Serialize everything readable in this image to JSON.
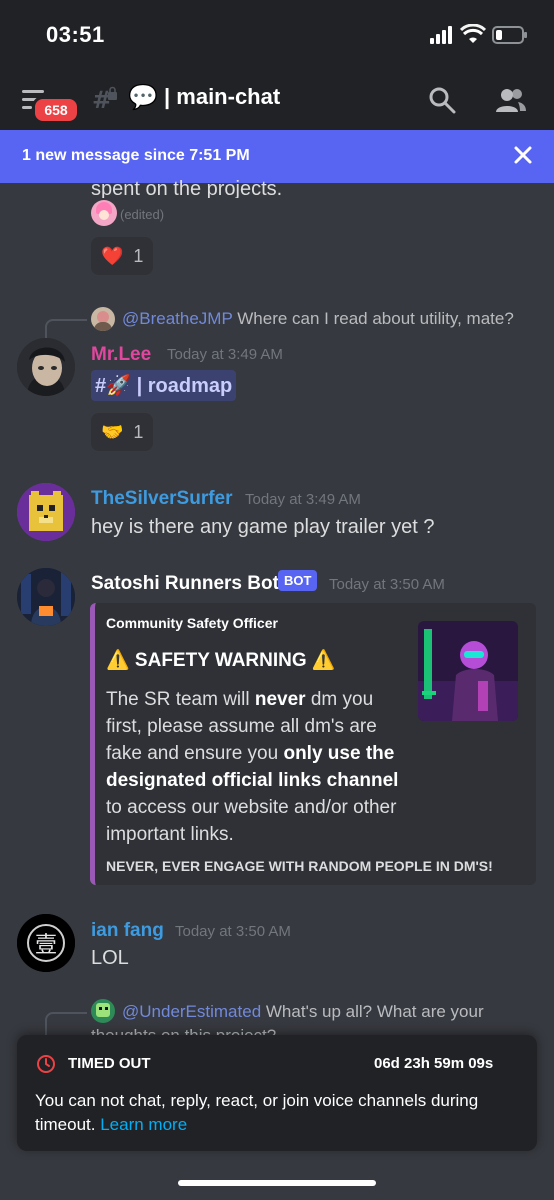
{
  "status_bar": {
    "time": "03:51"
  },
  "header": {
    "badge_count": "658",
    "channel_prefix": "💬",
    "channel_name": "| main-chat"
  },
  "new_messages_bar": {
    "text": "1 new message since 7:51 PM"
  },
  "messages": {
    "prev": {
      "text": "spent on the projects.",
      "edited": "(edited)",
      "reaction_emoji": "❤️",
      "reaction_count": "1"
    },
    "mrlee": {
      "reply_mention": "@BreatheJMP",
      "reply_text": "Where can I read about utility, mate?",
      "username": "Mr.Lee",
      "username_color": "#e0479e",
      "timestamp": "Today at 3:49 AM",
      "channel_link": "#🚀 | roadmap",
      "reaction_emoji": "🤝",
      "reaction_count": "1"
    },
    "silver": {
      "username": "TheSilverSurfer",
      "username_color": "#3e9be0",
      "timestamp": "Today at 3:49 AM",
      "text": "hey is there any game play trailer yet ?"
    },
    "bot": {
      "username": "Satoshi Runners Bot",
      "tag": "BOT",
      "timestamp": "Today at 3:50 AM",
      "embed": {
        "accent": "#9b59b6",
        "author": "Community Safety Officer",
        "title": "⚠️ SAFETY WARNING ⚠️",
        "desc_1": "The SR team will ",
        "desc_2": "never",
        "desc_3": " dm you first, please assume all dm's are fake and ensure you ",
        "desc_4": "only use the designated official links channel",
        "desc_5": " to access our website and/or other important links.",
        "footer": "NEVER, EVER ENGAGE WITH RANDOM PEOPLE IN DM'S!"
      }
    },
    "ian": {
      "username": "ian fang",
      "username_color": "#3e9be0",
      "timestamp": "Today at 3:50 AM",
      "text": "LOL"
    },
    "next": {
      "reply_mention": "@UnderEstimated",
      "reply_text": "What's up all? What are your",
      "reply_text_2": "thoughts on this project?"
    }
  },
  "timeout": {
    "title": "TIMED OUT",
    "timer": "06d 23h 59m 09s",
    "body": "You can not chat, reply, react, or join voice channels during timeout.",
    "link": "Learn more"
  }
}
